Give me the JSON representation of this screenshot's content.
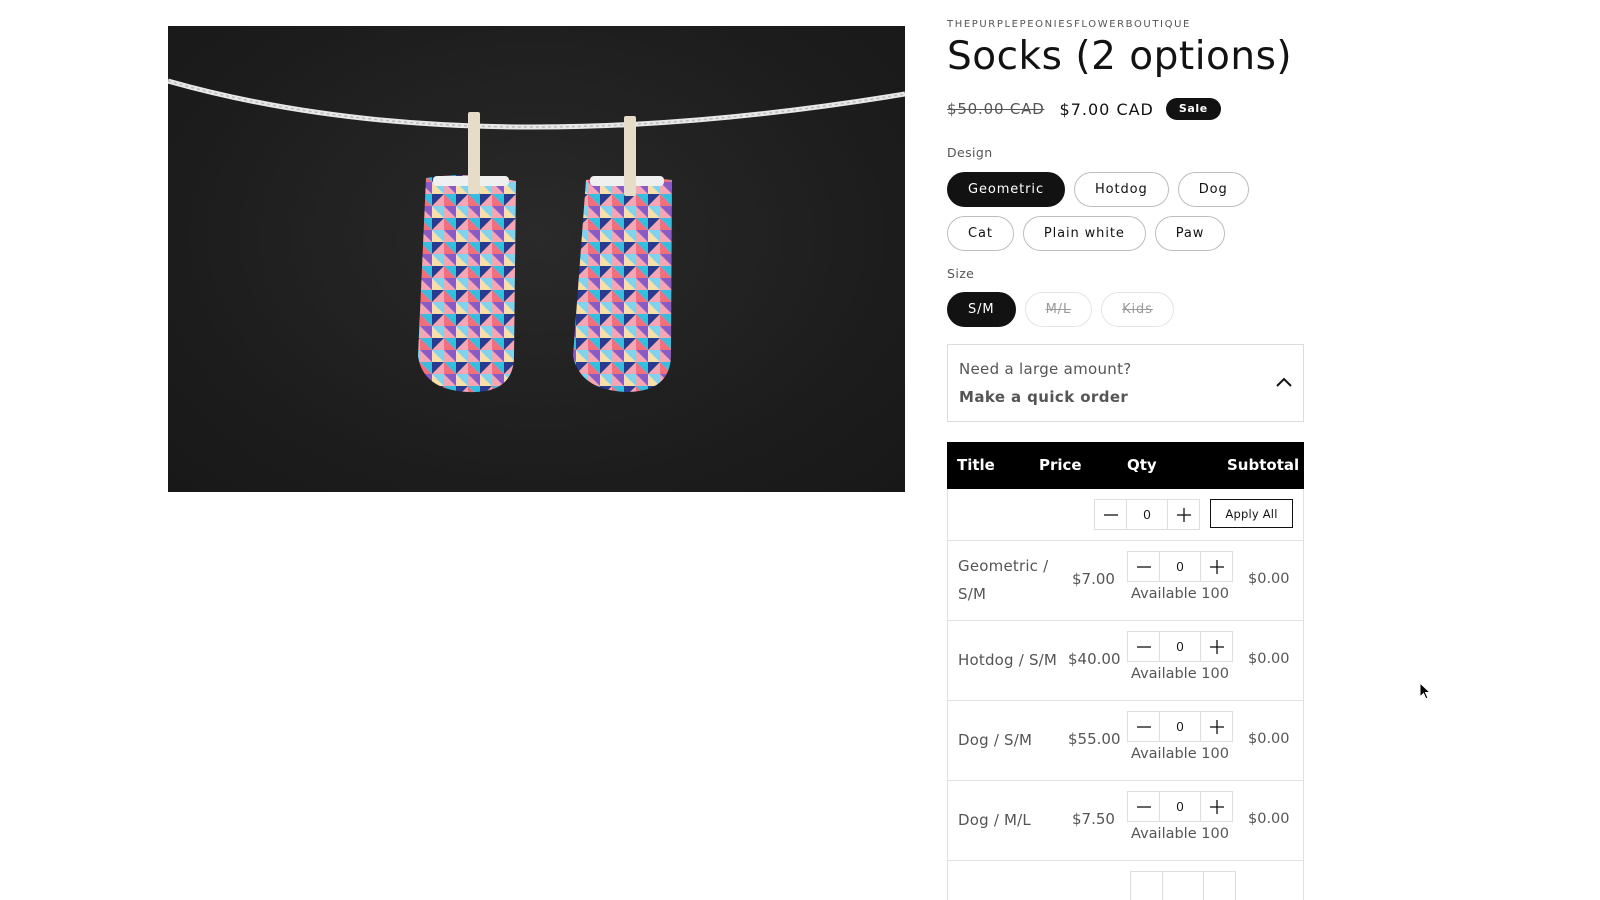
{
  "product": {
    "vendor": "THEPURPLEPEONIESFLOWERBOUTIQUE",
    "title": "Socks (2 options)",
    "price_regular": "$50.00 CAD",
    "price_sale": "$7.00 CAD",
    "badge": "Sale",
    "image_alt": "Two geometric-pattern socks hanging on a rope with clothespins"
  },
  "options": {
    "design": {
      "label": "Design",
      "values": [
        "Geometric",
        "Hotdog",
        "Dog",
        "Cat",
        "Plain white",
        "Paw"
      ],
      "selected": "Geometric"
    },
    "size": {
      "label": "Size",
      "values": [
        "S/M",
        "M/L",
        "Kids"
      ],
      "selected": "S/M",
      "unavailable": [
        "M/L",
        "Kids"
      ]
    }
  },
  "quick_order": {
    "line1": "Need a large amount?",
    "line2": "Make a quick order",
    "icon": "chevron-up-icon",
    "expanded": true
  },
  "table": {
    "headers": {
      "title": "Title",
      "price": "Price",
      "qty": "Qty",
      "subtotal": "Subtotal"
    },
    "apply_all": {
      "qty": "0",
      "label": "Apply All"
    },
    "rows": [
      {
        "title": "Geometric / S/M",
        "price": "$7.00",
        "qty": "0",
        "available": "Available 100",
        "subtotal": "$0.00"
      },
      {
        "title": "Hotdog / S/M",
        "price": "$40.00",
        "qty": "0",
        "available": "Available 100",
        "subtotal": "$0.00"
      },
      {
        "title": "Dog / S/M",
        "price": "$55.00",
        "qty": "0",
        "available": "Available 100",
        "subtotal": "$0.00"
      },
      {
        "title": "Dog / M/L",
        "price": "$7.50",
        "qty": "0",
        "available": "Available 100",
        "subtotal": "$0.00"
      }
    ]
  },
  "colors": {
    "primary": "#121212",
    "muted_text": "#555555",
    "border": "#e0e0e0",
    "image_bg": "#1c1c1c"
  }
}
